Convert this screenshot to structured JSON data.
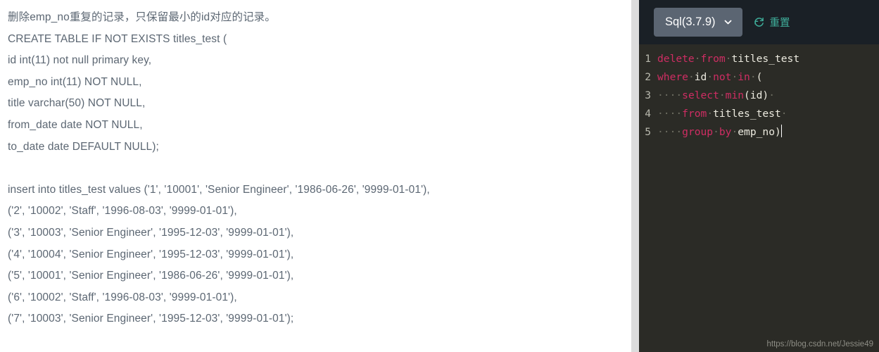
{
  "problem": {
    "lines": [
      "删除emp_no重复的记录，只保留最小的id对应的记录。",
      "CREATE TABLE IF NOT EXISTS titles_test (",
      "id int(11) not null primary key,",
      "emp_no int(11) NOT NULL,",
      "title varchar(50) NOT NULL,",
      "from_date date NOT NULL,",
      "to_date date DEFAULT NULL);",
      "",
      "insert into titles_test values ('1', '10001', 'Senior Engineer', '1986-06-26', '9999-01-01'),",
      "('2', '10002', 'Staff', '1996-08-03', '9999-01-01'),",
      "('3', '10003', 'Senior Engineer', '1995-12-03', '9999-01-01'),",
      "('4', '10004', 'Senior Engineer', '1995-12-03', '9999-01-01'),",
      "('5', '10001', 'Senior Engineer', '1986-06-26', '9999-01-01'),",
      "('6', '10002', 'Staff', '1996-08-03', '9999-01-01'),",
      "('7', '10003', 'Senior Engineer', '1995-12-03', '9999-01-01');"
    ]
  },
  "editor": {
    "language_label": "Sql(3.7.9)",
    "language_options": [
      "Sql(3.7.9)"
    ],
    "reset_label": "重置",
    "chevron_icon": "chevron-down-icon",
    "reset_icon": "refresh-icon",
    "accent_color": "#3fae9b",
    "keyword_color": "#cf2d63",
    "text_color": "#e8e8e0",
    "header_bg": "#1a2026",
    "code_bg": "#2b2b26",
    "select_bg": "#5b6572",
    "lines": [
      {
        "number": "1",
        "tokens": [
          {
            "t": "delete",
            "c": "kw"
          },
          {
            "t": "·",
            "c": "ws"
          },
          {
            "t": "from",
            "c": "kw"
          },
          {
            "t": "·",
            "c": "ws"
          },
          {
            "t": "titles_test",
            "c": "plain"
          }
        ]
      },
      {
        "number": "2",
        "tokens": [
          {
            "t": "where",
            "c": "kw"
          },
          {
            "t": "·",
            "c": "ws"
          },
          {
            "t": "id",
            "c": "plain"
          },
          {
            "t": "·",
            "c": "ws"
          },
          {
            "t": "not",
            "c": "kw"
          },
          {
            "t": "·",
            "c": "ws"
          },
          {
            "t": "in",
            "c": "kw"
          },
          {
            "t": "·",
            "c": "ws"
          },
          {
            "t": "(",
            "c": "plain"
          }
        ]
      },
      {
        "number": "3",
        "tokens": [
          {
            "t": "····",
            "c": "ws"
          },
          {
            "t": "select",
            "c": "kw"
          },
          {
            "t": "·",
            "c": "ws"
          },
          {
            "t": "min",
            "c": "kw"
          },
          {
            "t": "(id)",
            "c": "plain"
          },
          {
            "t": "·",
            "c": "ws"
          }
        ]
      },
      {
        "number": "4",
        "tokens": [
          {
            "t": "····",
            "c": "ws"
          },
          {
            "t": "from",
            "c": "kw"
          },
          {
            "t": "·",
            "c": "ws"
          },
          {
            "t": "titles_test",
            "c": "plain"
          },
          {
            "t": "·",
            "c": "ws"
          }
        ]
      },
      {
        "number": "5",
        "tokens": [
          {
            "t": "····",
            "c": "ws"
          },
          {
            "t": "group",
            "c": "kw"
          },
          {
            "t": "·",
            "c": "ws"
          },
          {
            "t": "by",
            "c": "kw"
          },
          {
            "t": "·",
            "c": "ws"
          },
          {
            "t": "emp_no)",
            "c": "plain"
          }
        ]
      }
    ],
    "cursor_line": 5
  },
  "watermark": "https://blog.csdn.net/Jessie49"
}
